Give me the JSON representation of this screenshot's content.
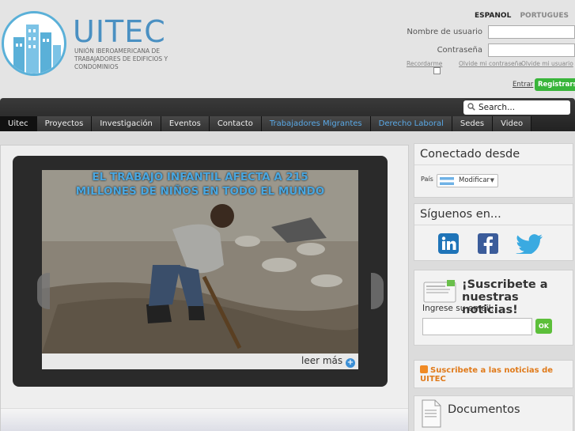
{
  "logo": {
    "name": "UITEC",
    "subtitle": "Unión Iberoamericana de Trabajadores de Edificios y Condominios"
  },
  "languages": {
    "active": "ESPANOL",
    "other": "PORTUGUES"
  },
  "login": {
    "username_label": "Nombre de usuario",
    "password_label": "Contraseña",
    "username_value": "",
    "password_value": "",
    "remember_label": "Recordarme",
    "forgot_password": "Olvide mi contraseña",
    "forgot_username": "Olvide mi usuario",
    "submit_label": "Entrar",
    "register_label": "Registrarse"
  },
  "search": {
    "placeholder": "Search..."
  },
  "nav": {
    "items": [
      {
        "label": "Uitec"
      },
      {
        "label": "Proyectos"
      },
      {
        "label": "Investigación"
      },
      {
        "label": "Eventos"
      },
      {
        "label": "Contacto"
      },
      {
        "label": "Trabajadores Migrantes"
      },
      {
        "label": "Derecho Laboral"
      },
      {
        "label": "Sedes"
      },
      {
        "label": "Video"
      }
    ]
  },
  "slider": {
    "caption": "EL TRABAJO INFANTIL AFECTA A 215 MILLONES DE NIÑOS EN TODO EL MUNDO",
    "read_more": "leer más",
    "plus": "+"
  },
  "sidebar": {
    "connected": {
      "title": "Conectado desde",
      "country_label": "País",
      "modify_label": "Modificar"
    },
    "follow": {
      "title": "Síguenos en..."
    },
    "subscribe": {
      "title": "¡Suscribete a nuestras noticias!",
      "email_label": "Ingrese su email:",
      "email_value": "",
      "ok_label": "OK"
    },
    "rss": {
      "link": "Suscribete a las noticias de UITEC"
    },
    "documents": {
      "title": "Documentos"
    }
  },
  "colors": {
    "accent_blue": "#4aa7e0",
    "register_green": "#39b53a",
    "rss_orange": "#e07a1a"
  }
}
